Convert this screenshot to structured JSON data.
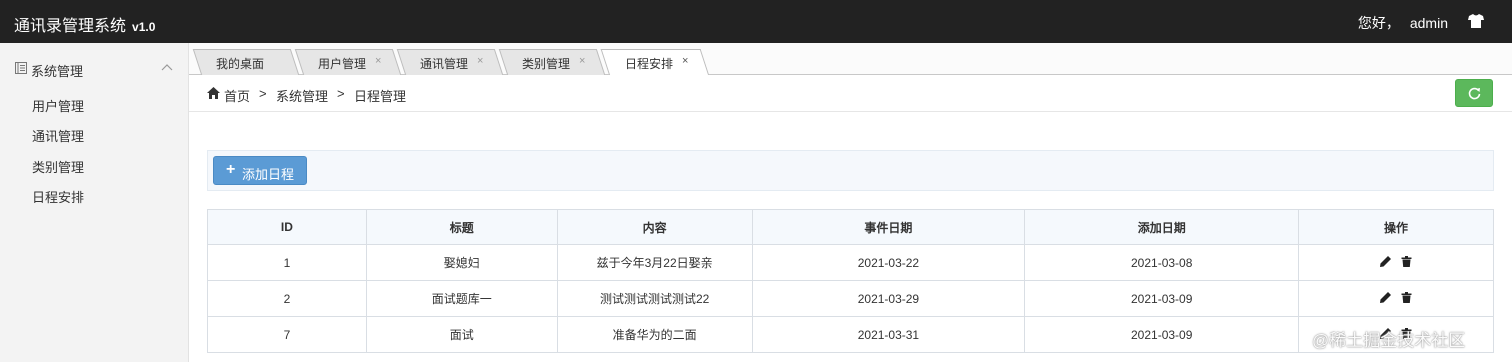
{
  "app": {
    "title": "通讯录管理系统",
    "version": "v1.0"
  },
  "header": {
    "greeting": "您好，",
    "username": "admin",
    "icon": "tshirt-icon"
  },
  "sidebar": {
    "group": {
      "label": "系统管理",
      "icon": "book-icon",
      "expand_icon": "chevron-up-icon"
    },
    "items": [
      {
        "label": "用户管理"
      },
      {
        "label": "通讯管理"
      },
      {
        "label": "类别管理"
      },
      {
        "label": "日程安排"
      }
    ]
  },
  "tabs": [
    {
      "label": "我的桌面",
      "closable": false,
      "active": false
    },
    {
      "label": "用户管理",
      "closable": true,
      "active": false
    },
    {
      "label": "通讯管理",
      "closable": true,
      "active": false
    },
    {
      "label": "类别管理",
      "closable": true,
      "active": false
    },
    {
      "label": "日程安排",
      "closable": true,
      "active": true
    }
  ],
  "tab_close_glyph": "×",
  "breadcrumb": {
    "items": [
      "首页",
      "系统管理",
      "日程管理"
    ],
    "separator": ">",
    "home_icon": "home-icon"
  },
  "toolbar": {
    "refresh_icon": "refresh-icon",
    "refresh_color": "#5cb85c"
  },
  "main": {
    "add_button": {
      "plus": "+",
      "label": "添加日程"
    }
  },
  "table": {
    "columns": [
      "ID",
      "标题",
      "内容",
      "事件日期",
      "添加日期",
      "操作"
    ],
    "rows": [
      {
        "id": "1",
        "title": "娶媳妇",
        "content": "兹于今年3月22日娶亲",
        "event_date": "2021-03-22",
        "add_date": "2021-03-08"
      },
      {
        "id": "2",
        "title": "面试题库一",
        "content": "测试测试测试测试22",
        "event_date": "2021-03-29",
        "add_date": "2021-03-09"
      },
      {
        "id": "7",
        "title": "面试",
        "content": "准备华为的二面",
        "event_date": "2021-03-31",
        "add_date": "2021-03-09"
      }
    ],
    "row_actions": [
      "edit-icon",
      "delete-icon"
    ]
  },
  "watermark": "@稀土掘金技术社区",
  "colors": {
    "topbar": "#222222",
    "accent": "#5b9bd5",
    "success": "#5cb85c"
  }
}
